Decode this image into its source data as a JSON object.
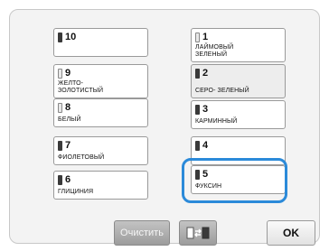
{
  "colors": {
    "highlight": "#2b8ad9",
    "spool_empty": "#e8e8e8",
    "spool_filled": "#3a3a3a"
  },
  "left_column": [
    {
      "number": "10",
      "name": "",
      "spool": "filled"
    },
    {
      "number": "9",
      "name": "ЖЕЛТО- ЗОЛОТИСТЫЙ",
      "spool": "empty"
    },
    {
      "number": "8",
      "name": "БЕЛЫЙ",
      "spool": "empty"
    },
    {
      "number": "7",
      "name": "ФИОЛЕТОВЫЙ",
      "spool": "filled"
    },
    {
      "number": "6",
      "name": "ГЛИЦИНИЯ",
      "spool": "filled"
    }
  ],
  "right_column": [
    {
      "number": "1",
      "name": "ЛАЙМОВЫЙ ЗЕЛЕНЫЙ",
      "spool": "empty"
    },
    {
      "number": "2",
      "name": "СЕРО- ЗЕЛЕНЫЙ",
      "spool": "filled"
    },
    {
      "number": "3",
      "name": "КАРМИННЫЙ",
      "spool": "filled"
    },
    {
      "number": "4",
      "name": "",
      "spool": "filled"
    },
    {
      "number": "5",
      "name": "ФУКСИН",
      "spool": "filled"
    }
  ],
  "buttons": {
    "clear_label": "Очистить",
    "swap_icon": "spool-swap-icon",
    "ok_label": "OK"
  }
}
